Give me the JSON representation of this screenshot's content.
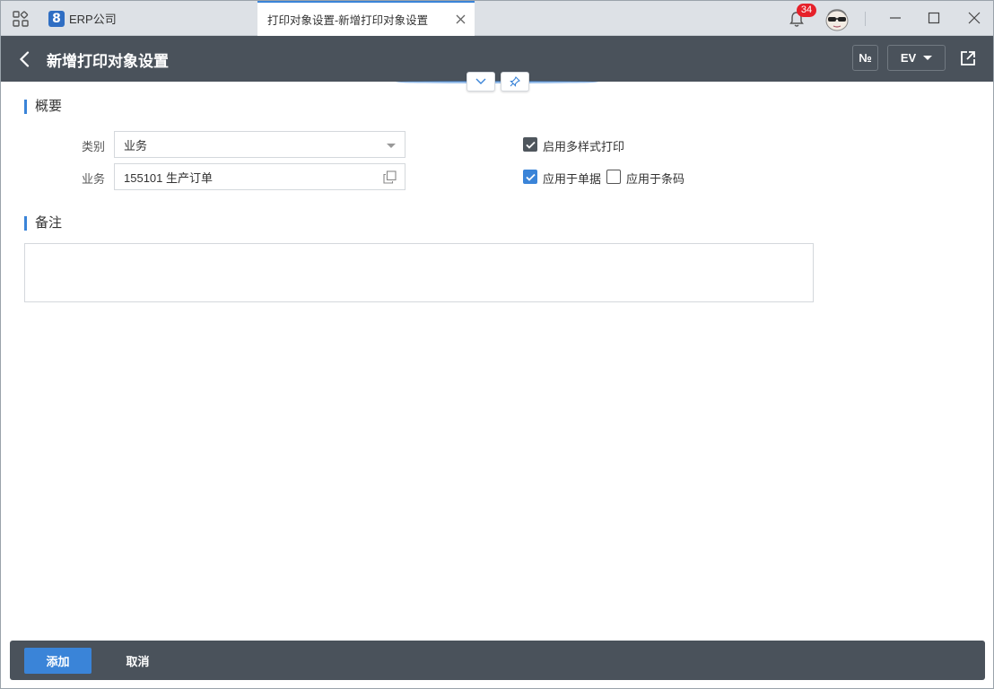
{
  "topbar": {
    "brand_logo": "8",
    "brand_name": "ERP公司",
    "active_tab": "打印对象设置-新增打印对象设置",
    "notification_count": "34",
    "icons": [
      "apps-grid-icon",
      "close-icon",
      "bell-icon",
      "avatar",
      "minimize-icon",
      "maximize-icon",
      "window-close-icon"
    ]
  },
  "header": {
    "title": "新增打印对象设置",
    "no_button": "№",
    "ev_button": "EV",
    "icons": [
      "back-arrow-icon",
      "share-icon",
      "chevron-down-icon",
      "pin-icon"
    ]
  },
  "overview": {
    "title": "概要",
    "category_label": "类别",
    "category_value": "业务",
    "business_label": "业务",
    "business_value": "155101 生产订单",
    "multi_style_print": {
      "label": "启用多样式打印",
      "checked": true
    },
    "apply_to_document": {
      "label": "应用于单据",
      "checked": true
    },
    "apply_to_barcode": {
      "label": "应用于条码",
      "checked": false
    }
  },
  "remark": {
    "title": "备注",
    "value": ""
  },
  "footer": {
    "add_label": "添加",
    "cancel_label": "取消"
  },
  "colors": {
    "accent": "#3a84d8",
    "header_bg": "#4a525b",
    "topbar_bg": "#dde1e6",
    "badge": "#e6212a"
  }
}
